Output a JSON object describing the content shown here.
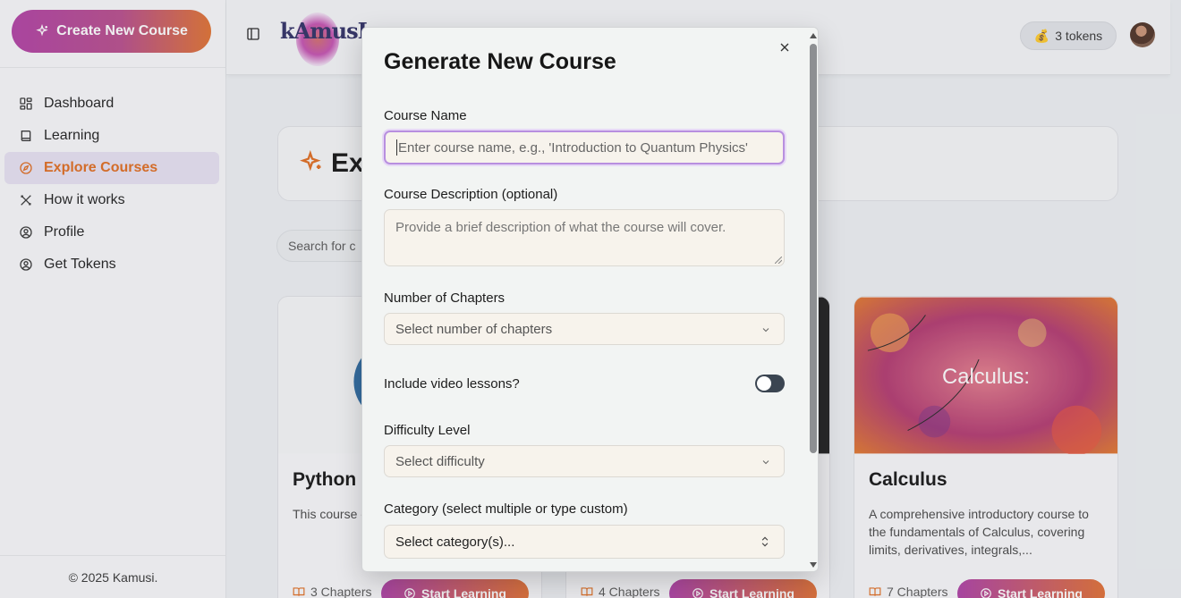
{
  "sidebar": {
    "create_label": "Create New Course",
    "items": [
      {
        "label": "Dashboard",
        "icon": "dashboard-icon"
      },
      {
        "label": "Learning",
        "icon": "book-icon"
      },
      {
        "label": "Explore Courses",
        "icon": "compass-icon",
        "active": true
      },
      {
        "label": "How it works",
        "icon": "tools-icon"
      },
      {
        "label": "Profile",
        "icon": "user-circle-icon"
      },
      {
        "label": "Get Tokens",
        "icon": "user-circle-icon"
      }
    ],
    "footer": "© 2025 Kamusi."
  },
  "header": {
    "logo_text": "kAmusI",
    "tokens_icon": "money-bag-icon",
    "tokens_label": "3 tokens"
  },
  "main": {
    "hero_title": "Ex",
    "search_placeholder": "Search for c",
    "courses": [
      {
        "title": "Python",
        "desc": "This course concepts of Learn about",
        "chapters": "3 Chapters",
        "button": "Start Learning"
      },
      {
        "title": "",
        "desc": "",
        "chapters": "4 Chapters",
        "button": "Start Learning"
      },
      {
        "title": "Calculus",
        "image_text": "Calculus:",
        "desc": "A comprehensive introductory course to the fundamentals of Calculus, covering limits, derivatives, integrals,...",
        "chapters": "7 Chapters",
        "button": "Start Learning"
      }
    ]
  },
  "modal": {
    "title": "Generate New Course",
    "course_name_label": "Course Name",
    "course_name_placeholder": "Enter course name, e.g., 'Introduction to Quantum Physics'",
    "description_label": "Course Description (optional)",
    "description_placeholder": "Provide a brief description of what the course will cover.",
    "chapters_label": "Number of Chapters",
    "chapters_placeholder": "Select number of chapters",
    "video_label": "Include video lessons?",
    "video_enabled": false,
    "difficulty_label": "Difficulty Level",
    "difficulty_placeholder": "Select difficulty",
    "category_label": "Category (select multiple or type custom)",
    "category_placeholder": "Select category(s)..."
  },
  "colors": {
    "accent_orange": "#e06a1c",
    "gradient_start": "#b03da3",
    "gradient_end": "#e0702e",
    "focus_ring": "#b88fdf"
  }
}
